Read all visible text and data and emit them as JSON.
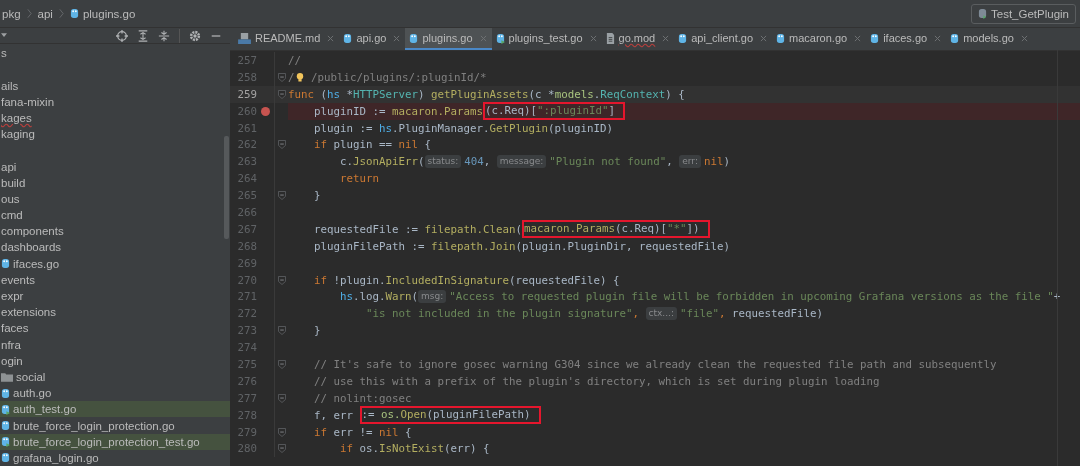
{
  "breadcrumb": [
    {
      "label": "pkg",
      "kind": "plain"
    },
    {
      "label": "api",
      "kind": "plain"
    },
    {
      "label": "plugins.go",
      "kind": "go"
    }
  ],
  "run_config": {
    "label": "Test_GetPlugin"
  },
  "sidebar": {
    "items": [
      {
        "name": "s",
        "spaced": false,
        "highlighted": false
      },
      {
        "name": "ails",
        "spaced": true,
        "highlighted": false
      },
      {
        "name": "fana-mixin",
        "spaced": false,
        "highlighted": false
      },
      {
        "name": "kages",
        "spaced": false,
        "highlighted": false
      },
      {
        "name": "kaging",
        "spaced": false,
        "highlighted": false
      },
      {
        "name": "api",
        "spaced": true,
        "highlighted": false
      },
      {
        "name": "build",
        "spaced": false,
        "highlighted": false
      },
      {
        "name": "ous",
        "spaced": false,
        "highlighted": false
      },
      {
        "name": "cmd",
        "spaced": false,
        "highlighted": false
      },
      {
        "name": "components",
        "spaced": false,
        "highlighted": false
      },
      {
        "name": "dashboards",
        "spaced": false,
        "highlighted": false,
        "children": [
          {
            "name": "ifaces.go",
            "kind": "go",
            "highlighted": false
          }
        ]
      },
      {
        "name": "events",
        "spaced": false,
        "highlighted": false
      },
      {
        "name": "expr",
        "spaced": false,
        "highlighted": false
      },
      {
        "name": "extensions",
        "spaced": false,
        "highlighted": false
      },
      {
        "name": "faces",
        "spaced": false,
        "highlighted": false
      },
      {
        "name": "nfra",
        "spaced": false,
        "highlighted": false
      },
      {
        "name": "ogin",
        "spaced": false,
        "highlighted": false,
        "children": [
          {
            "name": "social",
            "kind": "folder",
            "highlighted": false
          },
          {
            "name": "auth.go",
            "kind": "go",
            "highlighted": false
          },
          {
            "name": "auth_test.go",
            "kind": "go_test",
            "highlighted": true
          },
          {
            "name": "brute_force_login_protection.go",
            "kind": "go",
            "highlighted": false
          },
          {
            "name": "brute_force_login_protection_test.go",
            "kind": "go_test",
            "highlighted": true
          },
          {
            "name": "grafana_login.go",
            "kind": "go",
            "highlighted": false
          }
        ]
      }
    ]
  },
  "tabs": [
    {
      "label": "README.md",
      "kind": "md",
      "selected": false
    },
    {
      "label": "api.go",
      "kind": "go",
      "selected": false
    },
    {
      "label": "plugins.go",
      "kind": "go",
      "selected": true
    },
    {
      "label": "plugins_test.go",
      "kind": "go_test",
      "selected": false
    },
    {
      "label": "go.mod",
      "kind": "file",
      "selected": false
    },
    {
      "label": "api_client.go",
      "kind": "go",
      "selected": false
    },
    {
      "label": "macaron.go",
      "kind": "go",
      "selected": false
    },
    {
      "label": "ifaces.go",
      "kind": "go",
      "selected": false
    },
    {
      "label": "models.go",
      "kind": "go",
      "selected": false
    }
  ],
  "code": [
    {
      "num": "257",
      "current": false,
      "breakpoint": false,
      "fold": false,
      "tokens": [
        {
          "kind": "comment",
          "t": "//"
        }
      ]
    },
    {
      "num": "258",
      "current": false,
      "breakpoint": false,
      "fold": true,
      "tokens": [
        {
          "kind": "comment",
          "t": "/"
        },
        {
          "kind": "bulb"
        },
        {
          "kind": "comment",
          "t": " /public/plugins/:pluginId/*"
        }
      ]
    },
    {
      "num": "259",
      "current": true,
      "breakpoint": false,
      "fold": true,
      "tokens": [
        {
          "kind": "kw",
          "t": "func"
        },
        {
          "kind": "plain",
          "t": " ("
        },
        {
          "kind": "param",
          "t": "hs"
        },
        {
          "kind": "plain",
          "t": " *"
        },
        {
          "kind": "type",
          "t": "HTTPServer"
        },
        {
          "kind": "plain",
          "t": ") "
        },
        {
          "kind": "fn",
          "t": "getPluginAssets"
        },
        {
          "kind": "plain",
          "t": "(c *"
        },
        {
          "kind": "pkg",
          "t": "models"
        },
        {
          "kind": "plain",
          "t": "."
        },
        {
          "kind": "type",
          "t": "ReqContext"
        },
        {
          "kind": "plain",
          "t": ") {"
        }
      ]
    },
    {
      "num": "260",
      "current": false,
      "breakpoint": true,
      "fold": false,
      "tokens": [
        {
          "kind": "plain",
          "t": "    pluginID := "
        },
        {
          "kind": "fn",
          "t": "macaron.Params"
        },
        {
          "kind": "plain",
          "t": "(c.Req)[",
          "boxed": true
        },
        {
          "kind": "str",
          "t": "\":pluginId\"",
          "boxed": true
        },
        {
          "kind": "plain",
          "t": "]",
          "boxed": true
        }
      ]
    },
    {
      "num": "261",
      "current": false,
      "breakpoint": false,
      "fold": false,
      "tokens": [
        {
          "kind": "plain",
          "t": "    plugin := "
        },
        {
          "kind": "param",
          "t": "hs"
        },
        {
          "kind": "plain",
          "t": ".PluginManager."
        },
        {
          "kind": "fn",
          "t": "GetPlugin"
        },
        {
          "kind": "plain",
          "t": "(pluginID)"
        }
      ]
    },
    {
      "num": "262",
      "current": false,
      "breakpoint": false,
      "fold": true,
      "tokens": [
        {
          "kind": "kw",
          "t": "    if"
        },
        {
          "kind": "plain",
          "t": " plugin == "
        },
        {
          "kind": "kw",
          "t": "nil"
        },
        {
          "kind": "plain",
          "t": " {"
        }
      ]
    },
    {
      "num": "263",
      "current": false,
      "breakpoint": false,
      "fold": false,
      "tokens": [
        {
          "kind": "plain",
          "t": "        c."
        },
        {
          "kind": "fn",
          "t": "JsonApiErr"
        },
        {
          "kind": "plain",
          "t": "("
        },
        {
          "kind": "hint",
          "t": "status:"
        },
        {
          "kind": "num",
          "t": "404"
        },
        {
          "kind": "plain",
          "t": ", "
        },
        {
          "kind": "hint",
          "t": "message:"
        },
        {
          "kind": "str",
          "t": "\"Plugin not found\""
        },
        {
          "kind": "plain",
          "t": ", "
        },
        {
          "kind": "hint",
          "t": "err:"
        },
        {
          "kind": "kw",
          "t": "nil"
        },
        {
          "kind": "plain",
          "t": ")"
        }
      ]
    },
    {
      "num": "264",
      "current": false,
      "breakpoint": false,
      "fold": false,
      "tokens": [
        {
          "kind": "kw",
          "t": "        return"
        }
      ]
    },
    {
      "num": "265",
      "current": false,
      "breakpoint": false,
      "fold": true,
      "tokens": [
        {
          "kind": "plain",
          "t": "    }"
        }
      ]
    },
    {
      "num": "266",
      "current": false,
      "breakpoint": false,
      "fold": false
    },
    {
      "num": "267",
      "current": false,
      "breakpoint": false,
      "fold": false,
      "tokens": [
        {
          "kind": "plain",
          "t": "    requestedFile := "
        },
        {
          "kind": "fn",
          "t": "filepath.Clean"
        },
        {
          "kind": "plain",
          "t": "("
        },
        {
          "kind": "fn",
          "t": "macaron.Params",
          "boxed": true
        },
        {
          "kind": "plain",
          "t": "(c.Req)[",
          "boxed": true
        },
        {
          "kind": "str",
          "t": "\"*\"",
          "boxed": true
        },
        {
          "kind": "plain",
          "t": "])",
          "boxed": true
        }
      ]
    },
    {
      "num": "268",
      "current": false,
      "breakpoint": false,
      "fold": false,
      "tokens": [
        {
          "kind": "plain",
          "t": "    pluginFilePath := "
        },
        {
          "kind": "fn",
          "t": "filepath.Join"
        },
        {
          "kind": "plain",
          "t": "(plugin.PluginDir, requestedFile)"
        }
      ]
    },
    {
      "num": "269",
      "current": false,
      "breakpoint": false,
      "fold": false
    },
    {
      "num": "270",
      "current": false,
      "breakpoint": false,
      "fold": true,
      "tokens": [
        {
          "kind": "kw",
          "t": "    if"
        },
        {
          "kind": "plain",
          "t": " !plugin."
        },
        {
          "kind": "fn",
          "t": "IncludedInSignature"
        },
        {
          "kind": "plain",
          "t": "(requestedFile) {"
        }
      ]
    },
    {
      "num": "271",
      "current": false,
      "breakpoint": false,
      "fold": false,
      "tokens": [
        {
          "kind": "param",
          "t": "        hs"
        },
        {
          "kind": "plain",
          "t": ".log."
        },
        {
          "kind": "fn",
          "t": "Warn"
        },
        {
          "kind": "plain",
          "t": "("
        },
        {
          "kind": "hint",
          "t": "msg:"
        },
        {
          "kind": "str",
          "t": "\"Access to requested plugin file will be forbidden in upcoming Grafana versions as the file \""
        },
        {
          "kind": "plain",
          "t": "+"
        }
      ]
    },
    {
      "num": "272",
      "current": false,
      "breakpoint": false,
      "fold": false,
      "tokens": [
        {
          "kind": "str",
          "t": "            \"is not included in the plugin signature\""
        },
        {
          "kind": "kw",
          "t": ", "
        },
        {
          "kind": "hint",
          "t": "ctx...:"
        },
        {
          "kind": "str",
          "t": "\"file\""
        },
        {
          "kind": "kw",
          "t": ", "
        },
        {
          "kind": "plain",
          "t": "requestedFile)"
        }
      ]
    },
    {
      "num": "273",
      "current": false,
      "breakpoint": false,
      "fold": true,
      "tokens": [
        {
          "kind": "plain",
          "t": "    }"
        }
      ]
    },
    {
      "num": "274",
      "current": false,
      "breakpoint": false,
      "fold": false
    },
    {
      "num": "275",
      "current": false,
      "breakpoint": false,
      "fold": true,
      "tokens": [
        {
          "kind": "comment",
          "t": "    // It's safe to ignore gosec warning G304 since we already clean the requested file path and subsequently"
        }
      ]
    },
    {
      "num": "276",
      "current": false,
      "breakpoint": false,
      "fold": false,
      "tokens": [
        {
          "kind": "comment",
          "t": "    // use this with a prefix of the plugin's directory, which is set during plugin loading"
        }
      ]
    },
    {
      "num": "277",
      "current": false,
      "breakpoint": false,
      "fold": true,
      "tokens": [
        {
          "kind": "comment",
          "t": "    // nolint:gosec"
        }
      ]
    },
    {
      "num": "278",
      "current": false,
      "breakpoint": false,
      "fold": false,
      "tokens": [
        {
          "kind": "plain",
          "t": "    f, err "
        },
        {
          "kind": "plain",
          "t": ":= ",
          "boxed": true
        },
        {
          "kind": "pkg",
          "t": "os.",
          "boxed": true
        },
        {
          "kind": "fn",
          "t": "Open",
          "boxed": true
        },
        {
          "kind": "plain",
          "t": "(pluginFilePath)",
          "boxed": true
        }
      ]
    },
    {
      "num": "279",
      "current": false,
      "breakpoint": false,
      "fold": true,
      "tokens": [
        {
          "kind": "kw",
          "t": "    if"
        },
        {
          "kind": "plain",
          "t": " err != "
        },
        {
          "kind": "kw",
          "t": "nil"
        },
        {
          "kind": "plain",
          "t": " {"
        }
      ]
    },
    {
      "num": "280",
      "current": false,
      "breakpoint": false,
      "fold": true,
      "tokens": [
        {
          "kind": "kw",
          "t": "        if"
        },
        {
          "kind": "plain",
          "t": " os."
        },
        {
          "kind": "fn",
          "t": "IsNotExist"
        },
        {
          "kind": "plain",
          "t": "(err) {"
        }
      ]
    }
  ]
}
